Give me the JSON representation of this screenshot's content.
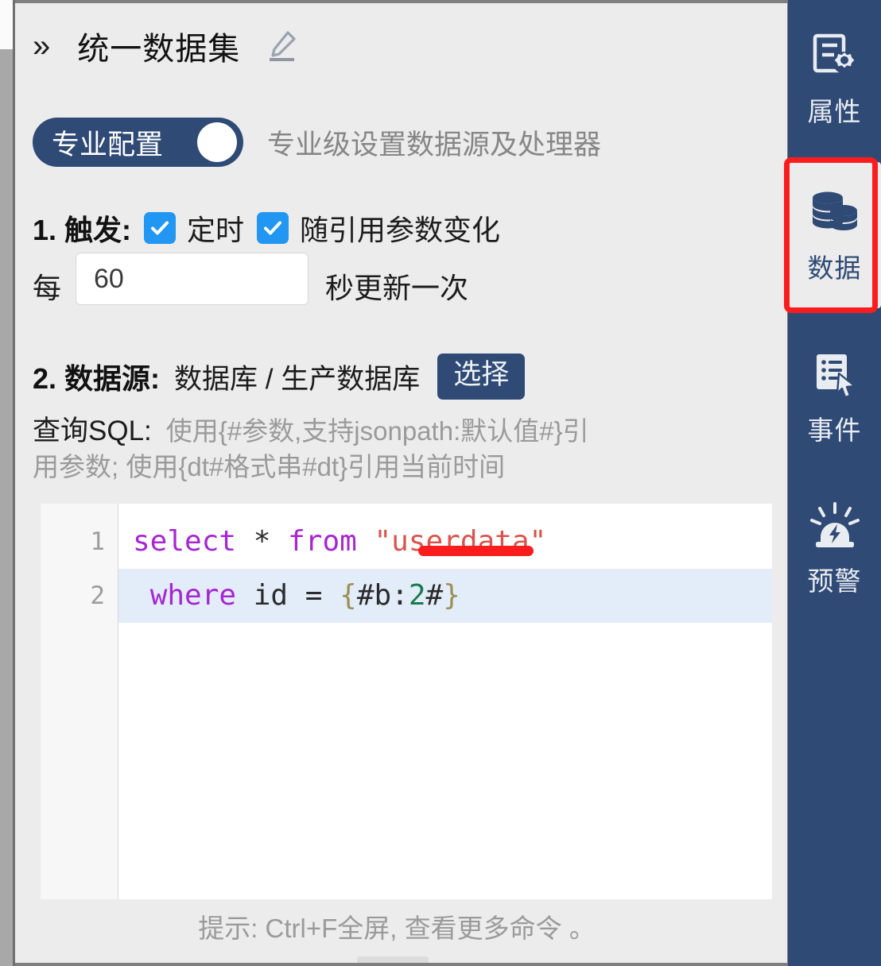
{
  "header": {
    "collapse_icon": "double-chevron-right-icon",
    "title": "统一数据集",
    "edit_icon": "pencil-edit-icon"
  },
  "pro_toggle": {
    "label": "专业配置",
    "state": "on",
    "description": "专业级设置数据源及处理器"
  },
  "trigger_section": {
    "heading": "1. 触发:",
    "checkboxes": [
      {
        "label": "定时",
        "checked": true
      },
      {
        "label": "随引用参数变化",
        "checked": true
      }
    ],
    "interval_prefix": "每",
    "interval_value": "60",
    "interval_placeholder": "",
    "interval_suffix": "秒更新一次"
  },
  "datasource_section": {
    "heading": "2. 数据源:",
    "path": "数据库 / 生产数据库",
    "select_button": "选择",
    "sql_label": "查询SQL:",
    "sql_hint_line1": "使用{#参数,支持jsonpath:默认值#}引",
    "sql_hint_line2": "用参数; 使用{dt#格式串#dt}引用当前时间"
  },
  "editor": {
    "line_numbers": [
      "1",
      "2"
    ],
    "lines": [
      {
        "number": "1",
        "active": false,
        "tokens": [
          {
            "text": "select",
            "type": "keyword"
          },
          {
            "text": " ",
            "type": "plain"
          },
          {
            "text": "*",
            "type": "operator"
          },
          {
            "text": " ",
            "type": "plain"
          },
          {
            "text": "from",
            "type": "keyword"
          },
          {
            "text": " ",
            "type": "plain"
          },
          {
            "text": "\"userdata\"",
            "type": "string"
          }
        ]
      },
      {
        "number": "2",
        "active": true,
        "tokens": [
          {
            "text": " ",
            "type": "plain"
          },
          {
            "text": "where",
            "type": "keyword"
          },
          {
            "text": " id ",
            "type": "plain"
          },
          {
            "text": "=",
            "type": "operator"
          },
          {
            "text": " ",
            "type": "plain"
          },
          {
            "text": "{",
            "type": "brace"
          },
          {
            "text": "#b:",
            "type": "plain"
          },
          {
            "text": "2",
            "type": "number"
          },
          {
            "text": "#",
            "type": "plain"
          },
          {
            "text": "}",
            "type": "brace"
          }
        ]
      }
    ],
    "annotation": "red-underline-on-parameter",
    "hint": "提示: Ctrl+F全屏, 查看更多命令 。"
  },
  "sidebar": {
    "items": [
      {
        "label": "属性",
        "icon": "properties-gear-document-icon",
        "active": false
      },
      {
        "label": "数据",
        "icon": "database-stack-icon",
        "active": true
      },
      {
        "label": "事件",
        "icon": "event-list-cursor-icon",
        "active": false
      },
      {
        "label": "预警",
        "icon": "alarm-siren-icon",
        "active": false
      }
    ],
    "highlight": "red-box-around-data-tab"
  },
  "colors": {
    "brand_navy": "#2e4a75",
    "checkbox_blue": "#2196f3",
    "annotation_red": "#fb1d1d",
    "panel_bg": "#ececec",
    "active_line": "#e3edfa"
  }
}
